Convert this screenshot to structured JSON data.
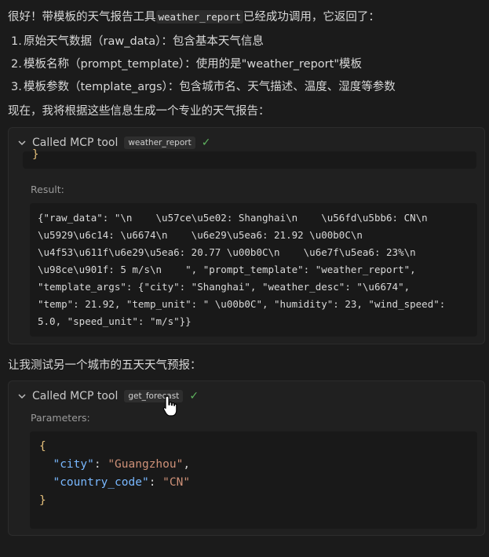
{
  "intro": {
    "before": "很好！带模板的天气报告工具",
    "code": "weather_report",
    "after": "已经成功调用，它返回了："
  },
  "list": [
    {
      "num": "1.",
      "text": "原始天气数据（raw_data）：包含基本天气信息"
    },
    {
      "num": "2.",
      "text": "模板名称（prompt_template）：使用的是\"weather_report\"模板"
    },
    {
      "num": "3.",
      "text": "模板参数（template_args）：包含城市名、天气描述、温度、湿度等参数"
    }
  ],
  "summary": "现在，我将根据这些信息生成一个专业的天气报告：",
  "tool1": {
    "called_label": "Called MCP tool",
    "tool_name": "weather_report",
    "check": "✓",
    "fragment": "}",
    "result_label": "Result:",
    "result_lines": [
      "{\"raw_data\": \"\\n    \\u57ce\\u5e02: Shanghai\\n    \\u56fd\\u5bb6: CN\\n",
      "\\u5929\\u6c14: \\u6674\\n    \\u6e29\\u5ea6: 21.92 \\u00b0C\\n",
      "\\u4f53\\u611f\\u6e29\\u5ea6: 20.77 \\u00b0C\\n    \\u6e7f\\u5ea6: 23%\\n",
      "\\u98ce\\u901f: 5 m/s\\n    \", \"prompt_template\": \"weather_report\",",
      "\"template_args\": {\"city\": \"Shanghai\", \"weather_desc\": \"\\u6674\",",
      "\"temp\": 21.92, \"temp_unit\": \" \\u00b0C\", \"humidity\": 23, \"wind_speed\":",
      "5.0, \"speed_unit\": \"m/s\"}}"
    ]
  },
  "transition": "让我测试另一个城市的五天天气预报：",
  "tool2": {
    "called_label": "Called MCP tool",
    "tool_name": "get_forecast",
    "check": "✓",
    "params_label": "Parameters:",
    "json": {
      "open": "{",
      "close": "}",
      "line1": {
        "key": "\"city\"",
        "colon": ": ",
        "value": "\"Guangzhou\"",
        "tail": ","
      },
      "line2": {
        "key": "\"country_code\"",
        "colon": ": ",
        "value": "\"CN\"",
        "tail": ""
      }
    }
  },
  "colors": {
    "background": "#1b1b1b",
    "card": "#202020",
    "code_bg": "#191919",
    "success_check": "#5fb45f",
    "json_key": "#79b8ff",
    "json_string": "#ce9178",
    "json_brace": "#e5c07b"
  },
  "icons": [
    "chevron-down-icon",
    "check-icon",
    "hand-pointer-cursor-icon"
  ]
}
